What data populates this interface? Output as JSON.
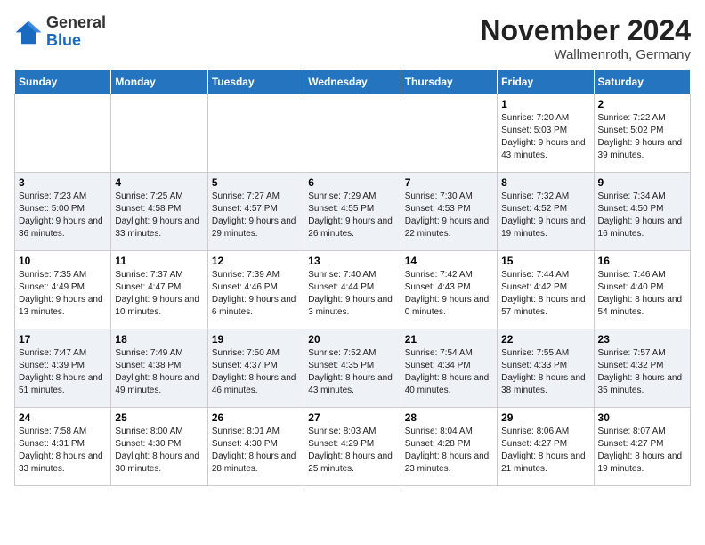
{
  "header": {
    "logo_general": "General",
    "logo_blue": "Blue",
    "month": "November 2024",
    "location": "Wallmenroth, Germany"
  },
  "days_of_week": [
    "Sunday",
    "Monday",
    "Tuesday",
    "Wednesday",
    "Thursday",
    "Friday",
    "Saturday"
  ],
  "weeks": [
    [
      {
        "day": "",
        "info": ""
      },
      {
        "day": "",
        "info": ""
      },
      {
        "day": "",
        "info": ""
      },
      {
        "day": "",
        "info": ""
      },
      {
        "day": "",
        "info": ""
      },
      {
        "day": "1",
        "info": "Sunrise: 7:20 AM\nSunset: 5:03 PM\nDaylight: 9 hours and 43 minutes."
      },
      {
        "day": "2",
        "info": "Sunrise: 7:22 AM\nSunset: 5:02 PM\nDaylight: 9 hours and 39 minutes."
      }
    ],
    [
      {
        "day": "3",
        "info": "Sunrise: 7:23 AM\nSunset: 5:00 PM\nDaylight: 9 hours and 36 minutes."
      },
      {
        "day": "4",
        "info": "Sunrise: 7:25 AM\nSunset: 4:58 PM\nDaylight: 9 hours and 33 minutes."
      },
      {
        "day": "5",
        "info": "Sunrise: 7:27 AM\nSunset: 4:57 PM\nDaylight: 9 hours and 29 minutes."
      },
      {
        "day": "6",
        "info": "Sunrise: 7:29 AM\nSunset: 4:55 PM\nDaylight: 9 hours and 26 minutes."
      },
      {
        "day": "7",
        "info": "Sunrise: 7:30 AM\nSunset: 4:53 PM\nDaylight: 9 hours and 22 minutes."
      },
      {
        "day": "8",
        "info": "Sunrise: 7:32 AM\nSunset: 4:52 PM\nDaylight: 9 hours and 19 minutes."
      },
      {
        "day": "9",
        "info": "Sunrise: 7:34 AM\nSunset: 4:50 PM\nDaylight: 9 hours and 16 minutes."
      }
    ],
    [
      {
        "day": "10",
        "info": "Sunrise: 7:35 AM\nSunset: 4:49 PM\nDaylight: 9 hours and 13 minutes."
      },
      {
        "day": "11",
        "info": "Sunrise: 7:37 AM\nSunset: 4:47 PM\nDaylight: 9 hours and 10 minutes."
      },
      {
        "day": "12",
        "info": "Sunrise: 7:39 AM\nSunset: 4:46 PM\nDaylight: 9 hours and 6 minutes."
      },
      {
        "day": "13",
        "info": "Sunrise: 7:40 AM\nSunset: 4:44 PM\nDaylight: 9 hours and 3 minutes."
      },
      {
        "day": "14",
        "info": "Sunrise: 7:42 AM\nSunset: 4:43 PM\nDaylight: 9 hours and 0 minutes."
      },
      {
        "day": "15",
        "info": "Sunrise: 7:44 AM\nSunset: 4:42 PM\nDaylight: 8 hours and 57 minutes."
      },
      {
        "day": "16",
        "info": "Sunrise: 7:46 AM\nSunset: 4:40 PM\nDaylight: 8 hours and 54 minutes."
      }
    ],
    [
      {
        "day": "17",
        "info": "Sunrise: 7:47 AM\nSunset: 4:39 PM\nDaylight: 8 hours and 51 minutes."
      },
      {
        "day": "18",
        "info": "Sunrise: 7:49 AM\nSunset: 4:38 PM\nDaylight: 8 hours and 49 minutes."
      },
      {
        "day": "19",
        "info": "Sunrise: 7:50 AM\nSunset: 4:37 PM\nDaylight: 8 hours and 46 minutes."
      },
      {
        "day": "20",
        "info": "Sunrise: 7:52 AM\nSunset: 4:35 PM\nDaylight: 8 hours and 43 minutes."
      },
      {
        "day": "21",
        "info": "Sunrise: 7:54 AM\nSunset: 4:34 PM\nDaylight: 8 hours and 40 minutes."
      },
      {
        "day": "22",
        "info": "Sunrise: 7:55 AM\nSunset: 4:33 PM\nDaylight: 8 hours and 38 minutes."
      },
      {
        "day": "23",
        "info": "Sunrise: 7:57 AM\nSunset: 4:32 PM\nDaylight: 8 hours and 35 minutes."
      }
    ],
    [
      {
        "day": "24",
        "info": "Sunrise: 7:58 AM\nSunset: 4:31 PM\nDaylight: 8 hours and 33 minutes."
      },
      {
        "day": "25",
        "info": "Sunrise: 8:00 AM\nSunset: 4:30 PM\nDaylight: 8 hours and 30 minutes."
      },
      {
        "day": "26",
        "info": "Sunrise: 8:01 AM\nSunset: 4:30 PM\nDaylight: 8 hours and 28 minutes."
      },
      {
        "day": "27",
        "info": "Sunrise: 8:03 AM\nSunset: 4:29 PM\nDaylight: 8 hours and 25 minutes."
      },
      {
        "day": "28",
        "info": "Sunrise: 8:04 AM\nSunset: 4:28 PM\nDaylight: 8 hours and 23 minutes."
      },
      {
        "day": "29",
        "info": "Sunrise: 8:06 AM\nSunset: 4:27 PM\nDaylight: 8 hours and 21 minutes."
      },
      {
        "day": "30",
        "info": "Sunrise: 8:07 AM\nSunset: 4:27 PM\nDaylight: 8 hours and 19 minutes."
      }
    ]
  ]
}
